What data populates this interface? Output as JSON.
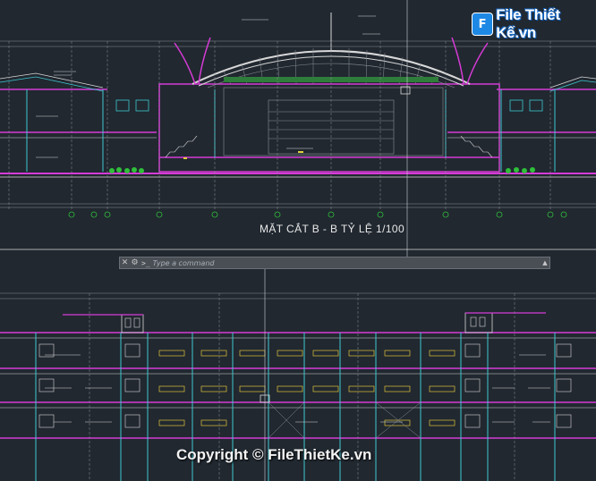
{
  "logo": {
    "badge": "F",
    "text": "File Thiết Kế.vn"
  },
  "drawing": {
    "section_title": "MẶT CẮT B - B     TỶ LỆ 1/100"
  },
  "command_line": {
    "close_glyph": "✕",
    "settings_glyph": "⚙",
    "prompt_glyph": ">_",
    "placeholder": "Type a command",
    "expand_glyph": "▲"
  },
  "watermark": {
    "text": "Copyright © FileThietKe.vn"
  },
  "colors": {
    "background": "#212830",
    "magenta": "#d63bd6",
    "cyan": "#3fc7d0",
    "white_line": "#d8d8d8",
    "green": "#2fbf3a",
    "gray_line": "#8a8f96"
  }
}
